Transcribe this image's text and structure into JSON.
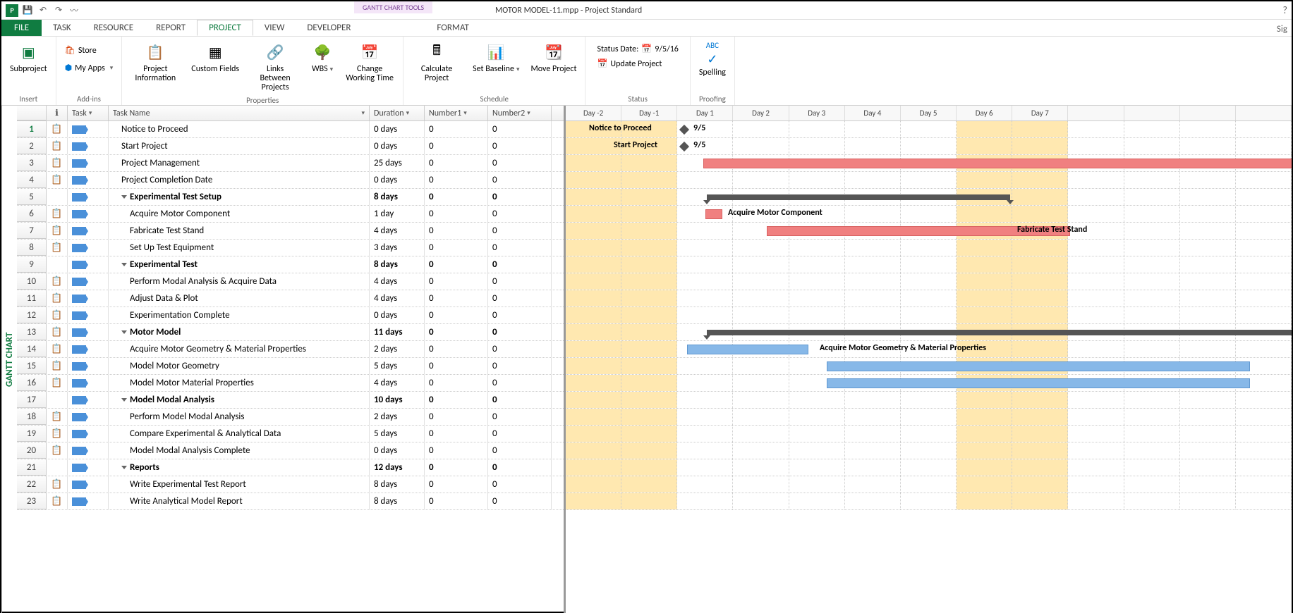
{
  "titlebar": {
    "title": "MOTOR MODEL-11.mpp - Project Standard",
    "tools": "GANTT CHART TOOLS",
    "sig": "Sig"
  },
  "tabs": {
    "file": "FILE",
    "task": "TASK",
    "resource": "RESOURCE",
    "report": "REPORT",
    "project": "PROJECT",
    "view": "VIEW",
    "developer": "DEVELOPER",
    "format": "FORMAT"
  },
  "ribbon": {
    "insert": {
      "label": "Insert",
      "subproject": "Subproject"
    },
    "addins": {
      "label": "Add-ins",
      "store": "Store",
      "myapps": "My Apps"
    },
    "properties": {
      "label": "Properties",
      "info": "Project Information",
      "custom": "Custom Fields",
      "links": "Links Between Projects",
      "wbs": "WBS",
      "chwt": "Change Working Time"
    },
    "schedule": {
      "label": "Schedule",
      "calc": "Calculate Project",
      "baseline": "Set Baseline",
      "move": "Move Project"
    },
    "status": {
      "label": "Status",
      "statusdate": "Status Date:",
      "date": "9/5/16",
      "update": "Update Project"
    },
    "proofing": {
      "label": "Proofing",
      "spelling": "Spelling",
      "abc": "ABC"
    }
  },
  "headers": {
    "task": "Task",
    "taskname": "Task Name",
    "duration": "Duration",
    "number1": "Number1",
    "number2": "Number2"
  },
  "sidelabel": "GANTT CHART",
  "days": [
    "Day -2",
    "Day -1",
    "Day 1",
    "Day 2",
    "Day 3",
    "Day 4",
    "Day 5",
    "Day 6",
    "Day 7"
  ],
  "rows": [
    {
      "n": 1,
      "ind": true,
      "name": "Notice to Proceed",
      "dur": "0 days",
      "n1": "0",
      "n2": "0",
      "bold": false,
      "lvl": 1
    },
    {
      "n": 2,
      "ind": true,
      "name": "Start Project",
      "dur": "0 days",
      "n1": "0",
      "n2": "0",
      "bold": false,
      "lvl": 1
    },
    {
      "n": 3,
      "ind": true,
      "name": "Project Management",
      "dur": "25 days",
      "n1": "0",
      "n2": "0",
      "bold": false,
      "lvl": 1
    },
    {
      "n": 4,
      "ind": true,
      "name": "Project Completion Date",
      "dur": "0 days",
      "n1": "0",
      "n2": "0",
      "bold": false,
      "lvl": 1
    },
    {
      "n": 5,
      "ind": false,
      "name": "Experimental Test Setup",
      "dur": "8 days",
      "n1": "0",
      "n2": "0",
      "bold": true,
      "lvl": 0
    },
    {
      "n": 6,
      "ind": true,
      "name": "Acquire Motor Component",
      "dur": "1 day",
      "n1": "0",
      "n2": "0",
      "bold": false,
      "lvl": 2
    },
    {
      "n": 7,
      "ind": true,
      "name": "Fabricate Test Stand",
      "dur": "4 days",
      "n1": "0",
      "n2": "0",
      "bold": false,
      "lvl": 2
    },
    {
      "n": 8,
      "ind": true,
      "name": "Set Up Test Equipment",
      "dur": "3 days",
      "n1": "0",
      "n2": "0",
      "bold": false,
      "lvl": 2
    },
    {
      "n": 9,
      "ind": false,
      "name": "Experimental Test",
      "dur": "8 days",
      "n1": "0",
      "n2": "0",
      "bold": true,
      "lvl": 0
    },
    {
      "n": 10,
      "ind": true,
      "name": "Perform Modal Analysis & Acquire Data",
      "dur": "4 days",
      "n1": "0",
      "n2": "0",
      "bold": false,
      "lvl": 2
    },
    {
      "n": 11,
      "ind": true,
      "name": "Adjust Data & Plot",
      "dur": "4 days",
      "n1": "0",
      "n2": "0",
      "bold": false,
      "lvl": 2
    },
    {
      "n": 12,
      "ind": true,
      "name": "Experimentation Complete",
      "dur": "0 days",
      "n1": "0",
      "n2": "0",
      "bold": false,
      "lvl": 2
    },
    {
      "n": 13,
      "ind": true,
      "name": "Motor Model",
      "dur": "11 days",
      "n1": "0",
      "n2": "0",
      "bold": true,
      "lvl": 0
    },
    {
      "n": 14,
      "ind": true,
      "name": "Acquire Motor Geometry & Material Properties",
      "dur": "2 days",
      "n1": "0",
      "n2": "0",
      "bold": false,
      "lvl": 2
    },
    {
      "n": 15,
      "ind": true,
      "name": "Model Motor Geometry",
      "dur": "5 days",
      "n1": "0",
      "n2": "0",
      "bold": false,
      "lvl": 2
    },
    {
      "n": 16,
      "ind": true,
      "name": "Model Motor Material Properties",
      "dur": "4 days",
      "n1": "0",
      "n2": "0",
      "bold": false,
      "lvl": 2
    },
    {
      "n": 17,
      "ind": false,
      "name": "Model Modal Analysis",
      "dur": "10 days",
      "n1": "0",
      "n2": "0",
      "bold": true,
      "lvl": 0
    },
    {
      "n": 18,
      "ind": true,
      "name": "Perform Model Modal Analysis",
      "dur": "2 days",
      "n1": "0",
      "n2": "0",
      "bold": false,
      "lvl": 2
    },
    {
      "n": 19,
      "ind": true,
      "name": "Compare Experimental & Analytical Data",
      "dur": "5 days",
      "n1": "0",
      "n2": "0",
      "bold": false,
      "lvl": 2
    },
    {
      "n": 20,
      "ind": true,
      "name": "Model Modal Analysis Complete",
      "dur": "0 days",
      "n1": "0",
      "n2": "0",
      "bold": false,
      "lvl": 2
    },
    {
      "n": 21,
      "ind": false,
      "name": "Reports",
      "dur": "12 days",
      "n1": "0",
      "n2": "0",
      "bold": true,
      "lvl": 0
    },
    {
      "n": 22,
      "ind": true,
      "name": "Write Experimental Test Report",
      "dur": "8 days",
      "n1": "0",
      "n2": "0",
      "bold": false,
      "lvl": 2
    },
    {
      "n": 23,
      "ind": true,
      "name": "Write Analytical Model Report",
      "dur": "8 days",
      "n1": "0",
      "n2": "0",
      "bold": false,
      "lvl": 2
    }
  ],
  "gantt": {
    "labels": {
      "notice": "Notice to Proceed",
      "start": "Start Project",
      "date": "9/5",
      "acq": "Acquire Motor Component",
      "fab": "Fabricate Test Stand",
      "geom": "Acquire Motor Geometry & Material Properties"
    }
  }
}
